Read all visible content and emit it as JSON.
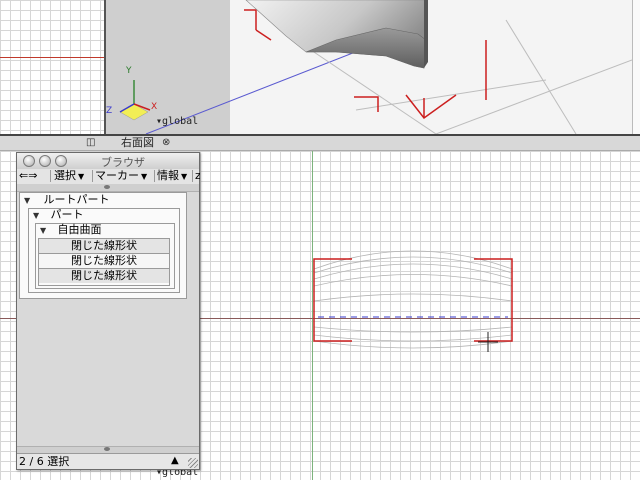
{
  "viewport": {
    "view_title": "右面図",
    "global_label_top": "global",
    "global_label_bottom": "global",
    "axis_labels": {
      "x": "X",
      "y": "Y",
      "z": "Z"
    }
  },
  "browser": {
    "title": "ブラウザ",
    "toolbar": {
      "nav_arrows": "⇐⇒",
      "select_menu": "選択",
      "marker_menu": "マーカー",
      "info_menu": "情報",
      "overflow_menu": "z"
    },
    "tree": {
      "root": "ルートパート",
      "part": "パート",
      "surface": "自由曲面",
      "items": [
        "閉じた線形状",
        "閉じた線形状",
        "閉じた線形状"
      ]
    },
    "status": "2 / 6 選択"
  },
  "colors": {
    "selection_red": "#cc1f1f",
    "axis_green": "#7db37d",
    "axis_yellow": "#f2ee55",
    "curve_blue": "#3a3acc"
  }
}
